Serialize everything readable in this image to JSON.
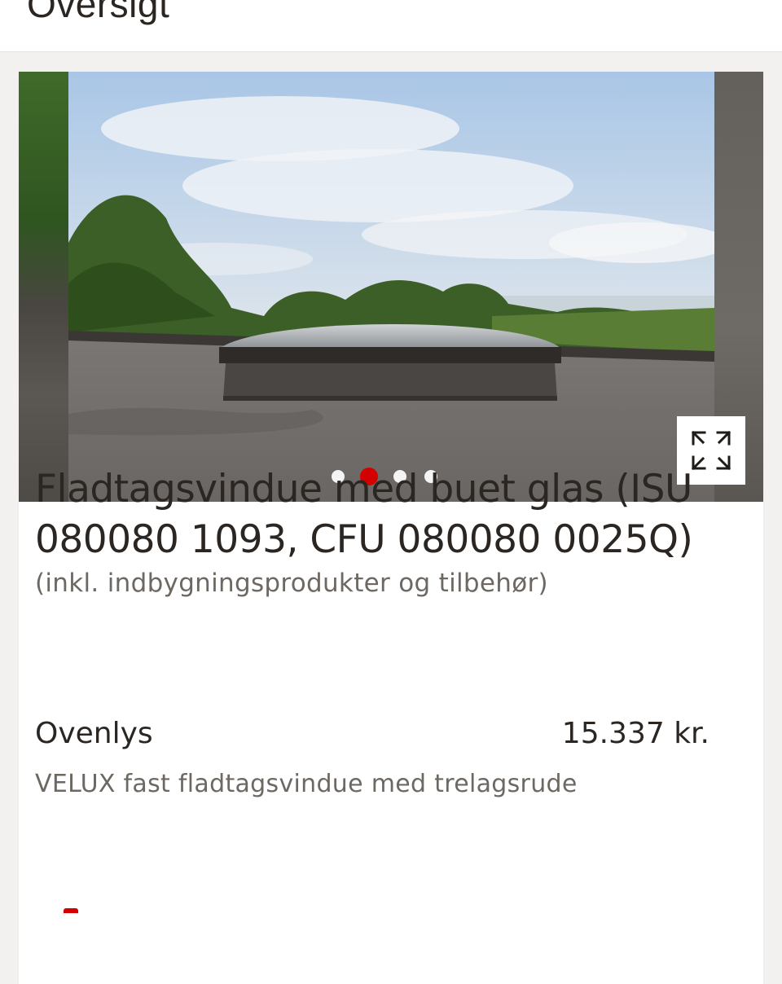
{
  "header": {
    "title": "Oversigt"
  },
  "gallery": {
    "slide_count": 4,
    "active_index": 1,
    "colors": {
      "active_dot": "#d40000",
      "inactive_dot": "#f4f4f4"
    },
    "expand_icon": "expand-arrows-icon"
  },
  "product": {
    "title": "Fladtagsvindue med buet glas (ISU 080080 1093, CFU 080080 0025Q)",
    "subtitle": "(inkl. indbygningsprodukter og tilbehør)"
  },
  "price": {
    "label": "Ovenlys",
    "value": "15.337 kr.",
    "description": "VELUX fast fladtagsvindue med trelagsrude"
  },
  "colors": {
    "accent": "#d40000",
    "text": "#2b2622",
    "muted": "#6e6862",
    "background": "#f3f1ef"
  }
}
